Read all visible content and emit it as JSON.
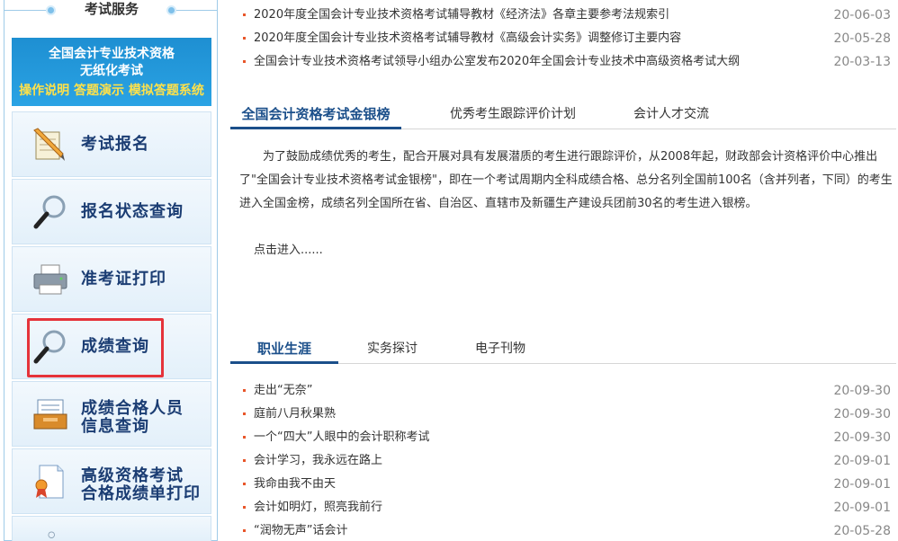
{
  "sidebar": {
    "title": "考试服务",
    "banner": {
      "line1": "全国会计专业技术资格",
      "line2": "无纸化考试",
      "line3": "操作说明 答题演示 模拟答题系统"
    },
    "items": [
      {
        "label": "考试报名",
        "icon": "notepad-pencil-icon"
      },
      {
        "label": "报名状态查询",
        "icon": "magnifier-icon"
      },
      {
        "label": "准考证打印",
        "icon": "printer-icon"
      },
      {
        "label": "成绩查询",
        "icon": "magnifier-icon"
      },
      {
        "label_line1": "成绩合格人员",
        "label_line2": "信息查询",
        "icon": "inbox-tray-icon"
      },
      {
        "label_line1": "高级资格考试",
        "label_line2": "合格成绩单打印",
        "icon": "certificate-ribbon-icon"
      }
    ]
  },
  "top_news": [
    {
      "title": "2020年度全国会计专业技术资格考试辅导教材《经济法》各章主要参考法规索引",
      "date": "20-06-03"
    },
    {
      "title": "2020年度全国会计专业技术资格考试辅导教材《高级会计实务》调整修订主要内容",
      "date": "20-05-28"
    },
    {
      "title": "全国会计专业技术资格考试领导小组办公室发布2020年全国会计专业技术中高级资格考试大纲",
      "date": "20-03-13"
    }
  ],
  "tabs1": [
    "全国会计资格考试金银榜",
    "优秀考生跟踪评价计划",
    "会计人才交流"
  ],
  "gold_list": {
    "text": "为了鼓励成绩优秀的考生，配合开展对具有发展潜质的考生进行跟踪评价，从2008年起，财政部会计资格评价中心推出了\"全国会计专业技术资格考试金银榜\"，即在一个考试周期内全科成绩合格、总分名列全国前100名（含并列者，下同）的考生进入全国金榜，成绩名列全国所在省、自治区、直辖市及新疆生产建设兵团前30名的考生进入银榜。",
    "link": "点击进入......"
  },
  "tabs2": [
    "职业生涯",
    "实务探讨",
    "电子刊物"
  ],
  "career_news": [
    {
      "title": "走出“无奈”",
      "date": "20-09-30"
    },
    {
      "title": "庭前八月秋果熟",
      "date": "20-09-30"
    },
    {
      "title": "一个“四大”人眼中的会计职称考试",
      "date": "20-09-30"
    },
    {
      "title": "会计学习，我永远在路上",
      "date": "20-09-01"
    },
    {
      "title": "我命由我不由天",
      "date": "20-09-01"
    },
    {
      "title": "会计如明灯，照亮我前行",
      "date": "20-09-01"
    },
    {
      "title": "“润物无声”话会计",
      "date": "20-05-28"
    }
  ],
  "colors": {
    "accent": "#1b4f8a",
    "bullet": "#e8562a",
    "highlight": "#e5333a",
    "banner": "#2aa3e4"
  }
}
